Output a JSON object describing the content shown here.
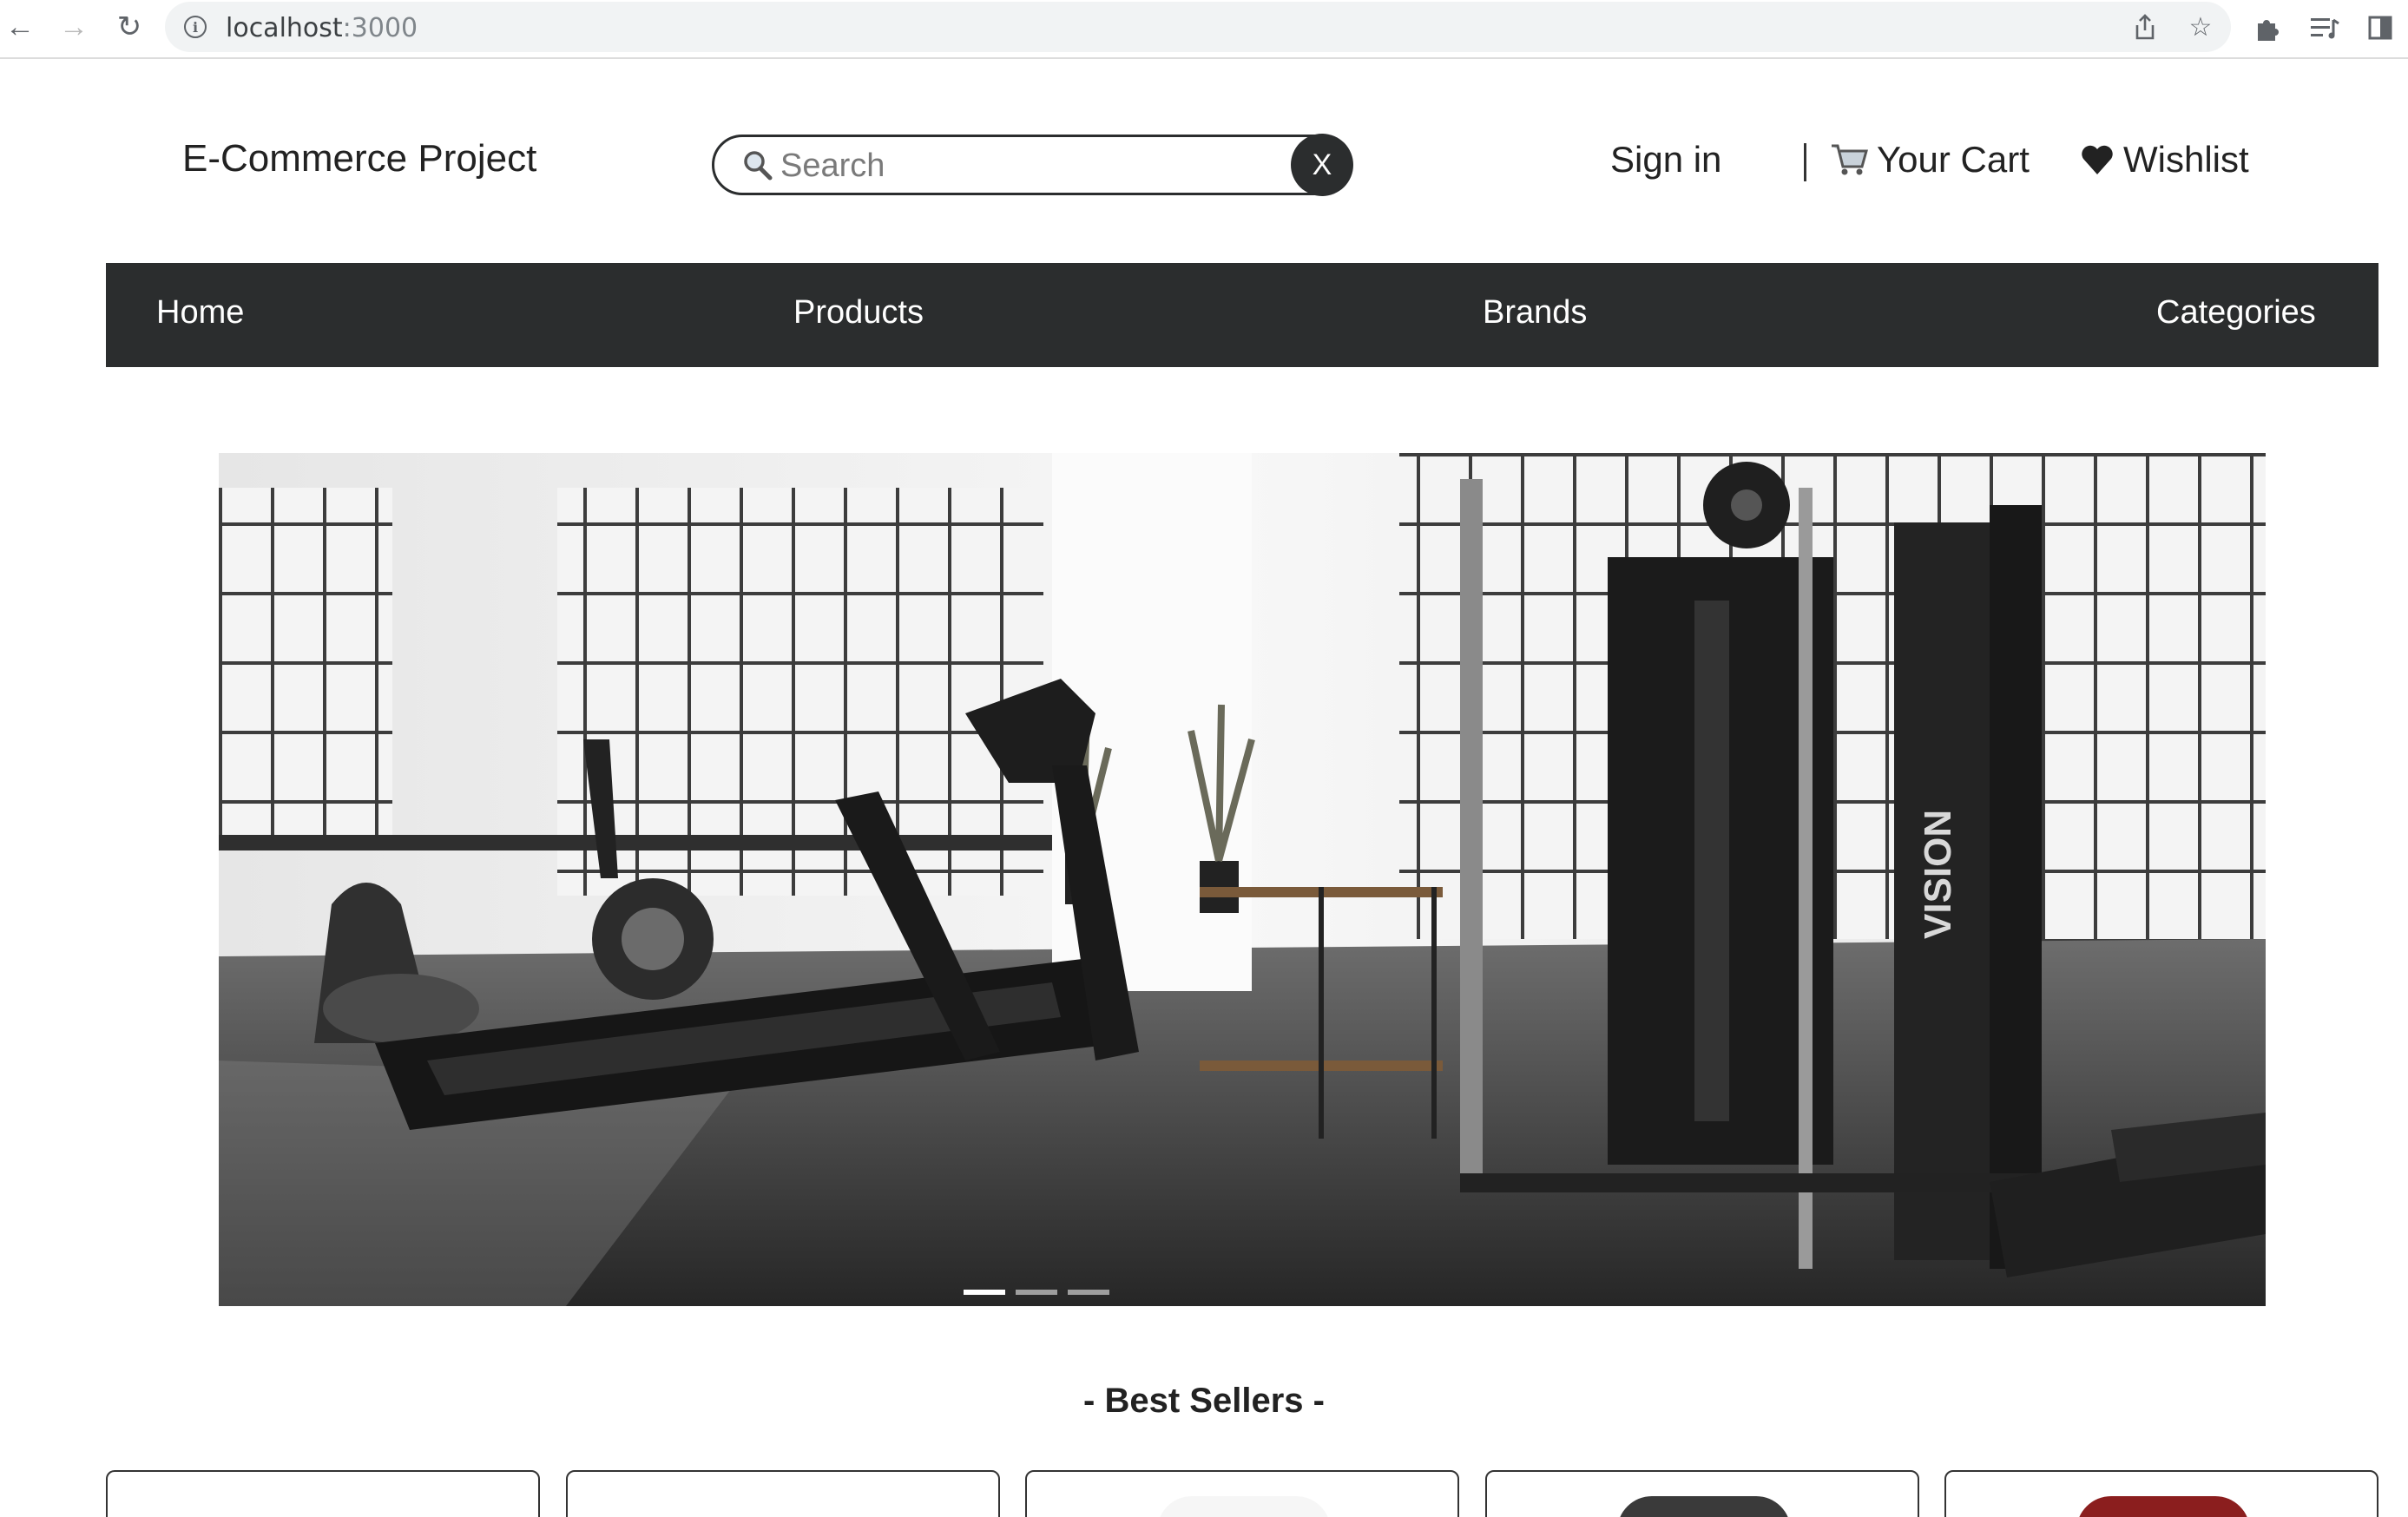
{
  "browser": {
    "url_host": "localhost",
    "url_port": ":3000",
    "back_label": "←",
    "forward_label": "→",
    "reload_label": "↻"
  },
  "header": {
    "logo": "E-Commerce Project",
    "search": {
      "placeholder": "Search",
      "value": "",
      "clear_label": "X"
    },
    "sign_in": "Sign in",
    "cart": "Your Cart",
    "wishlist": "Wishlist"
  },
  "nav": {
    "items": [
      {
        "label": "Home"
      },
      {
        "label": "Products"
      },
      {
        "label": "Brands"
      },
      {
        "label": "Categories"
      }
    ]
  },
  "hero": {
    "slide_count": 3,
    "active_slide": 1,
    "brand_mark": "VISION"
  },
  "best_sellers": {
    "title": "- Best Sellers -",
    "card_count": 5,
    "thumb_colors": [
      "#ffffff",
      "#ffffff",
      "#f0f0f0",
      "#3a3a3a",
      "#8b1e1e"
    ]
  },
  "colors": {
    "navbar_bg": "#2b2d2e",
    "navbar_text": "#ffffff",
    "search_clear_bg": "#2b2d2e"
  }
}
